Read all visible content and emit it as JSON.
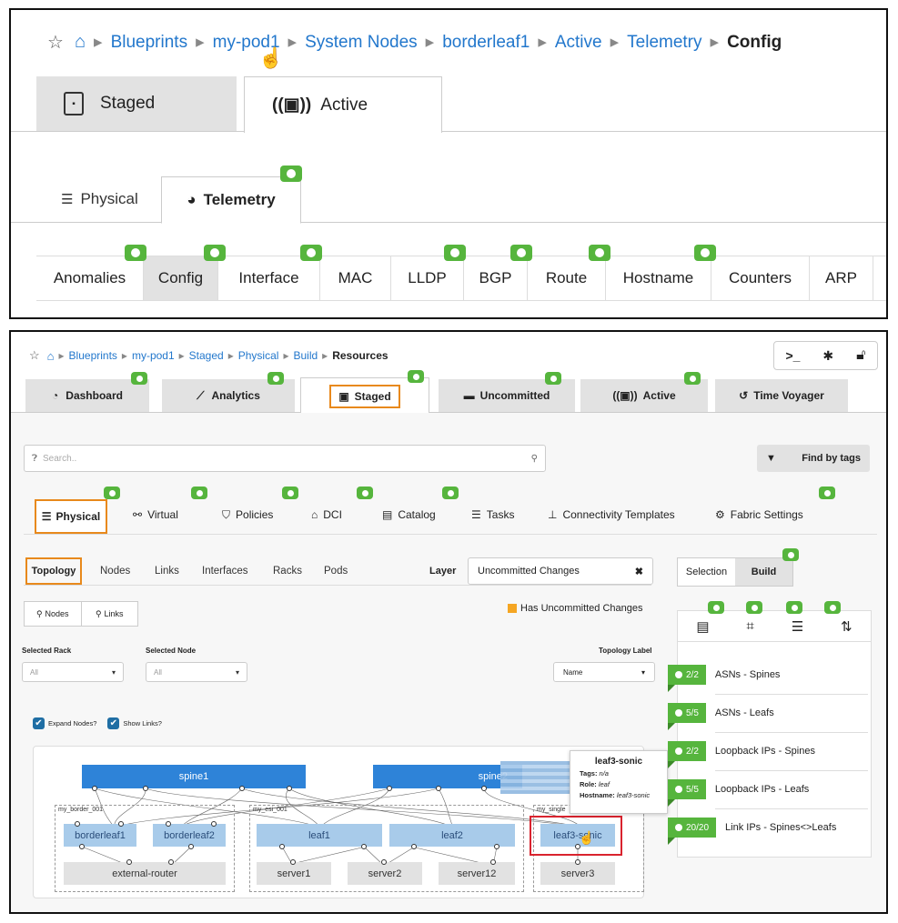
{
  "top": {
    "breadcrumb": [
      "Blueprints",
      "my-pod1",
      "System Nodes",
      "borderleaf1",
      "Active",
      "Telemetry"
    ],
    "breadcrumb_current": "Config",
    "tabs": {
      "staged": "Staged",
      "active": "Active"
    },
    "subtabs": {
      "physical": "Physical",
      "telemetry": "Telemetry"
    },
    "service_tabs": [
      "Anomalies",
      "Config",
      "Interface",
      "MAC",
      "LLDP",
      "BGP",
      "Route",
      "Hostname",
      "Counters",
      "ARP"
    ]
  },
  "bottom": {
    "breadcrumb": [
      "Blueprints",
      "my-pod1",
      "Staged",
      "Physical",
      "Build"
    ],
    "breadcrumb_current": "Resources",
    "terminal_icon": ">_",
    "tabs": [
      "Dashboard",
      "Analytics",
      "Staged",
      "Uncommitted",
      "Active",
      "Time Voyager"
    ],
    "search_placeholder": "Search..",
    "find_by_tags": "Find by tags",
    "subtabs": [
      "Physical",
      "Virtual",
      "Policies",
      "DCI",
      "Catalog",
      "Tasks",
      "Connectivity Templates",
      "Fabric Settings"
    ],
    "view_tabs": [
      "Topology",
      "Nodes",
      "Links",
      "Interfaces",
      "Racks",
      "Pods"
    ],
    "layer_label": "Layer",
    "layer_value": "Uncommitted Changes",
    "selection_tabs": [
      "Selection",
      "Build"
    ],
    "legend": "Has Uncommitted Changes",
    "query_buttons": [
      "Nodes",
      "Links"
    ],
    "selected_rack_label": "Selected Rack",
    "selected_rack_value": "All",
    "selected_node_label": "Selected Node",
    "selected_node_value": "All",
    "topology_label": "Topology Label",
    "topology_label_value": "Name",
    "expand_nodes": "Expand Nodes?",
    "show_links": "Show Links?",
    "topology": {
      "spines": [
        "spine1",
        "spine2"
      ],
      "groups": [
        "my_border_001",
        "my_esi_001",
        "my_single"
      ],
      "leafs": [
        "borderleaf1",
        "borderleaf2",
        "leaf1",
        "leaf2",
        "leaf3-sonic"
      ],
      "servers": [
        "external-router",
        "server1",
        "server2",
        "server12",
        "server3"
      ]
    },
    "tooltip": {
      "title": "leaf3-sonic",
      "tags_label": "Tags:",
      "tags": "n/a",
      "role_label": "Role:",
      "role": "leaf",
      "hostname_label": "Hostname:",
      "hostname": "leaf3-sonic"
    },
    "resources": [
      {
        "count": "2/2",
        "label": "ASNs - Spines"
      },
      {
        "count": "5/5",
        "label": "ASNs - Leafs"
      },
      {
        "count": "2/2",
        "label": "Loopback IPs - Spines"
      },
      {
        "count": "5/5",
        "label": "Loopback IPs - Leafs"
      },
      {
        "count": "20/20",
        "label": "Link IPs - Spines<>Leafs"
      }
    ],
    "colors": {
      "accent": "#2277cc",
      "ok": "#56b53d",
      "highlight": "#e8891c",
      "alert": "#d9232e",
      "node": "#2e83d8"
    }
  }
}
